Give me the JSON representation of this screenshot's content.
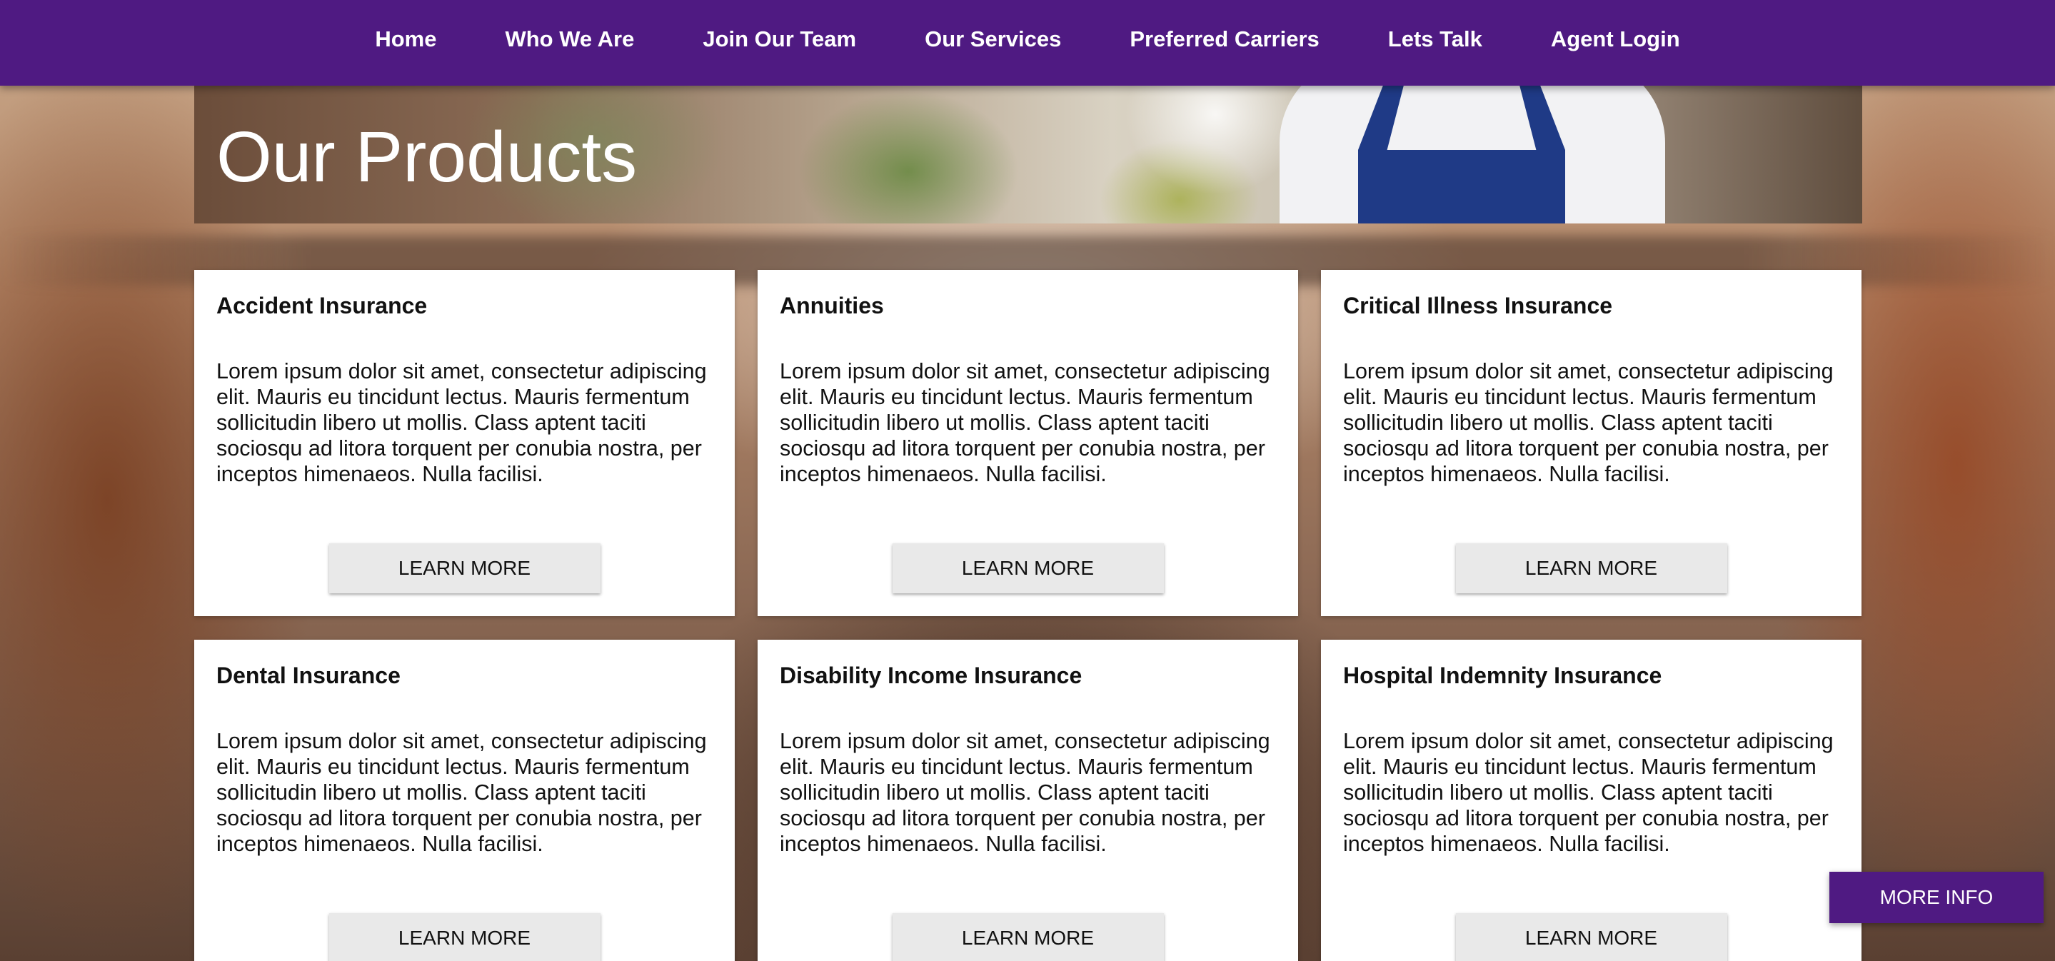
{
  "nav": {
    "items": [
      "Home",
      "Who We Are",
      "Join Our Team",
      "Our Services",
      "Preferred Carriers",
      "Lets Talk",
      "Agent Login"
    ]
  },
  "hero": {
    "title": "Our Products"
  },
  "products": [
    {
      "title": "Accident Insurance",
      "body": "Lorem ipsum dolor sit amet, consectetur adipiscing elit. Mauris eu tincidunt lectus. Mauris fermentum sollicitudin libero ut mollis. Class aptent taciti sociosqu ad litora torquent per conubia nostra, per inceptos himenaeos. Nulla facilisi.",
      "button": "LEARN MORE"
    },
    {
      "title": "Annuities",
      "body": "Lorem ipsum dolor sit amet, consectetur adipiscing elit. Mauris eu tincidunt lectus. Mauris fermentum sollicitudin libero ut mollis. Class aptent taciti sociosqu ad litora torquent per conubia nostra, per inceptos himenaeos. Nulla facilisi.",
      "button": "LEARN MORE"
    },
    {
      "title": "Critical Illness Insurance",
      "body": "Lorem ipsum dolor sit amet, consectetur adipiscing elit. Mauris eu tincidunt lectus. Mauris fermentum sollicitudin libero ut mollis. Class aptent taciti sociosqu ad litora torquent per conubia nostra, per inceptos himenaeos. Nulla facilisi.",
      "button": "LEARN MORE"
    },
    {
      "title": "Dental Insurance",
      "body": "Lorem ipsum dolor sit amet, consectetur adipiscing elit. Mauris eu tincidunt lectus. Mauris fermentum sollicitudin libero ut mollis. Class aptent taciti sociosqu ad litora torquent per conubia nostra, per inceptos himenaeos. Nulla facilisi.",
      "button": "LEARN MORE"
    },
    {
      "title": "Disability Income Insurance",
      "body": "Lorem ipsum dolor sit amet, consectetur adipiscing elit. Mauris eu tincidunt lectus. Mauris fermentum sollicitudin libero ut mollis. Class aptent taciti sociosqu ad litora torquent per conubia nostra, per inceptos himenaeos. Nulla facilisi.",
      "button": "LEARN MORE"
    },
    {
      "title": "Hospital Indemnity Insurance",
      "body": "Lorem ipsum dolor sit amet, consectetur adipiscing elit. Mauris eu tincidunt lectus. Mauris fermentum sollicitudin libero ut mollis. Class aptent taciti sociosqu ad litora torquent per conubia nostra, per inceptos himenaeos. Nulla facilisi.",
      "button": "LEARN MORE"
    }
  ],
  "more_info": {
    "label": "MORE INFO"
  },
  "colors": {
    "brand_purple": "#4f1a82",
    "button_gray": "#e9e9e9",
    "card_bg": "#ffffff"
  }
}
